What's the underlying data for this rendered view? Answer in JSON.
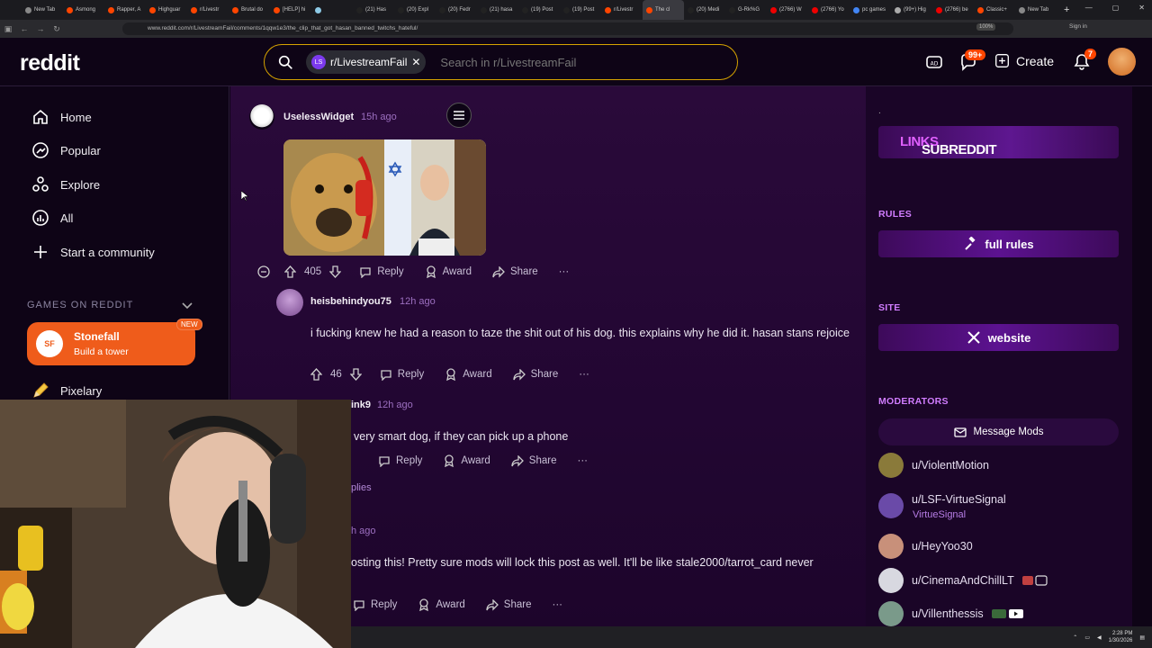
{
  "browser": {
    "tabs": [
      {
        "label": "New Tab",
        "color": "#888"
      },
      {
        "label": "Asmong",
        "color": "#ff4500"
      },
      {
        "label": "Rapper, A",
        "color": "#ff4500"
      },
      {
        "label": "Highguar",
        "color": "#ff4500"
      },
      {
        "label": "r/Livestr",
        "color": "#ff4500"
      },
      {
        "label": "Brutal do",
        "color": "#ff4500"
      },
      {
        "label": "[HELP] hi",
        "color": "#ff4500"
      },
      {
        "label": "",
        "color": "#8ecae6"
      },
      {
        "label": "(21) Has",
        "color": "#222"
      },
      {
        "label": "(20) Expl",
        "color": "#222"
      },
      {
        "label": "(20) Fedr",
        "color": "#222"
      },
      {
        "label": "(21) hasa",
        "color": "#222"
      },
      {
        "label": "(19) Post",
        "color": "#222"
      },
      {
        "label": "(19) Post",
        "color": "#222"
      },
      {
        "label": "r/Livestr",
        "color": "#ff4500"
      },
      {
        "label": "The cl",
        "color": "#ff4500"
      },
      {
        "label": "(20) Medi",
        "color": "#222"
      },
      {
        "label": "G-Rk%G",
        "color": "#222"
      },
      {
        "label": "(2766) W",
        "color": "#e00"
      },
      {
        "label": "(2766) Yo",
        "color": "#e00"
      },
      {
        "label": "pc games",
        "color": "#4285f4"
      },
      {
        "label": "(99+) Hig",
        "color": "#aaa"
      },
      {
        "label": "(2766) be",
        "color": "#e00"
      },
      {
        "label": "Classic+",
        "color": "#ff4500"
      },
      {
        "label": "New Tab",
        "color": "#888"
      }
    ],
    "url": "www.reddit.com/r/LivestreamFail/comments/1qqw1e3/the_clip_that_got_hasan_banned_twitchs_hateful/",
    "zoom": "100%",
    "signin": "Sign in"
  },
  "header": {
    "logo": "reddit",
    "search_chip": "r/LivestreamFail",
    "chip_avatar": "LS",
    "search_placeholder": "Search in r/LivestreamFail",
    "chat_badge": "99+",
    "notif_badge": "7",
    "create_label": "Create"
  },
  "sidebar": {
    "nav": [
      {
        "label": "Home",
        "icon": "home-icon"
      },
      {
        "label": "Popular",
        "icon": "popular-icon"
      },
      {
        "label": "Explore",
        "icon": "explore-icon"
      },
      {
        "label": "All",
        "icon": "all-icon"
      },
      {
        "label": "Start a community",
        "icon": "plus-icon"
      }
    ],
    "games_header": "GAMES ON REDDIT",
    "game_feature": {
      "title": "Stonefall",
      "subtitle": "Build a tower",
      "badge": "NEW"
    },
    "pixelary": "Pixelary"
  },
  "comments": [
    {
      "user": "UselessWidget",
      "time": "15h ago",
      "votes": "405",
      "has_image": true
    },
    {
      "user": "heisbehindyou75",
      "time": "12h ago",
      "text": "i fucking knew he had a reason to taze the shit out of his dog. this explains why he did it. hasan stans rejoice",
      "votes": "46"
    },
    {
      "user": "ink9",
      "time": "12h ago",
      "text": "very smart dog, if they can pick up a phone"
    },
    {
      "more_replies": "plies",
      "time": "h ago",
      "text": "osting this! Pretty sure mods will lock this post as well. It'll be like stale2000/tarrot_card never"
    }
  ],
  "actions": {
    "reply": "Reply",
    "award": "Award",
    "share": "Share",
    "more": "···"
  },
  "rightbar": {
    "dot": ".",
    "banner_a": "SUBREDDIT ",
    "banner_b": "LINKS",
    "rules_header": "RULES",
    "rules_btn": "full rules",
    "site_header": "SITE",
    "site_btn": "website",
    "mods_header": "MODERATORS",
    "message_mods": "Message Mods",
    "mods": [
      {
        "name": "u/ViolentMotion",
        "color": "#8a7a3a"
      },
      {
        "name": "u/LSF-VirtueSignal",
        "flair": "VirtueSignal",
        "color": "#6a4aa8"
      },
      {
        "name": "u/HeyYoo30",
        "color": "#c8907a"
      },
      {
        "name": "u/CinemaAndChillLT",
        "color": "#d8d8e0"
      },
      {
        "name": "u/Villenthessis",
        "color": "#7a9a8a"
      }
    ]
  },
  "taskbar": {
    "time": "2:28 PM",
    "date": "1/30/2026"
  }
}
